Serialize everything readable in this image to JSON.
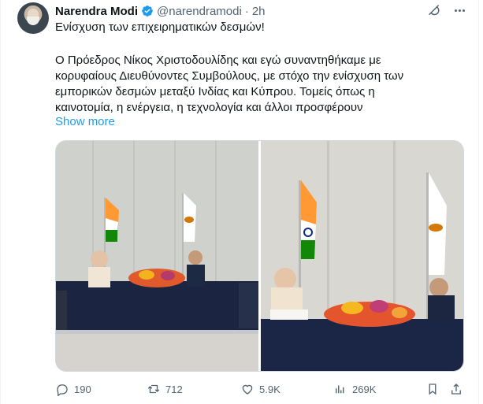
{
  "author": {
    "name": "Narendra Modi",
    "handle": "@narendramodi",
    "separator": "·",
    "time": "2h"
  },
  "tweet": {
    "title_line": "Ενίσχυση των επιχειρηματικών δεσμών!",
    "body": "Ο Πρόεδρος Νίκος Χριστοδουλίδης και εγώ συναντηθήκαμε με κορυφαίους Διευθύνοντες Συμβούλους, με στόχο την ενίσχυση των εμπορικών δεσμών μεταξύ Ινδίας και Κύπρου. Τομείς όπως η καινοτομία, η ενέργεια, η τεχνολογία και άλλοι προσφέρουν",
    "show_more": "Show more"
  },
  "stats": {
    "replies": "190",
    "reposts": "712",
    "likes": "5.9K",
    "views": "269K"
  },
  "colors": {
    "accent": "#1d9bf0",
    "muted": "#536471",
    "verified": "#1d9bf0"
  },
  "icons": {
    "verified": "verified-badge-icon",
    "grok": "grok-icon",
    "more": "more-icon",
    "reply": "reply-icon",
    "repost": "repost-icon",
    "like": "heart-icon",
    "views": "views-icon",
    "bookmark": "bookmark-icon",
    "share": "share-icon"
  }
}
